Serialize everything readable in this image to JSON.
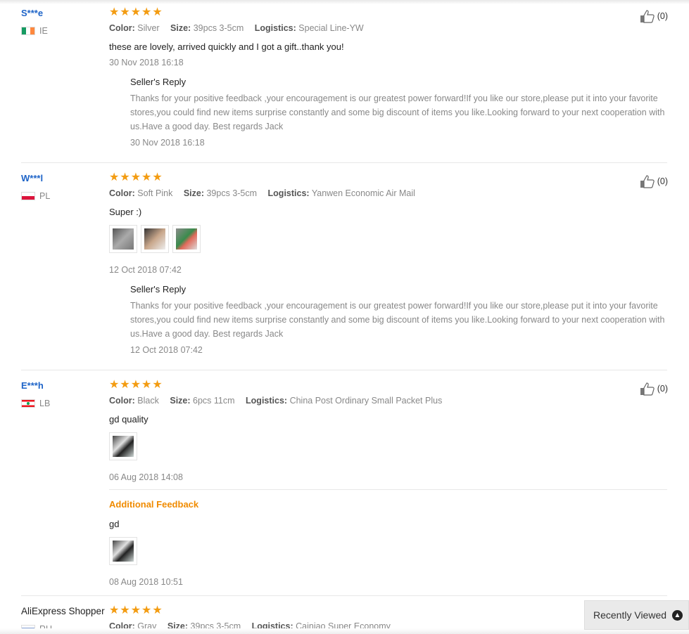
{
  "reviews": [
    {
      "user": "S***e",
      "country": "IE",
      "flag": "ireland-flag",
      "color_label": "Color:",
      "color": "Silver",
      "size_label": "Size:",
      "size": "39pcs 3-5cm",
      "logistics_label": "Logistics:",
      "logistics": "Special Line-YW",
      "text": "these are lovely, arrived quickly and I got a gift..thank you!",
      "date": "30 Nov 2018 16:18",
      "helpful": "(0)",
      "reply": {
        "title": "Seller's Reply",
        "body": "Thanks for your positive feedback ,your encouragement is our greatest power forward!If you like our store,please put it into your favorite stores,you could find new items surprise constantly and some big discount of items you like.Looking forward to your next cooperation with us.Have a good day. Best regards Jack",
        "date": "30 Nov 2018 16:18"
      }
    },
    {
      "user": "W***l",
      "country": "PL",
      "flag": "poland-flag",
      "color_label": "Color:",
      "color": "Soft Pink",
      "size_label": "Size:",
      "size": "39pcs 3-5cm",
      "logistics_label": "Logistics:",
      "logistics": "Yanwen Economic Air Mail",
      "text": "Super :)",
      "date": "12 Oct 2018 07:42",
      "helpful": "(0)",
      "reply": {
        "title": "Seller's Reply",
        "body": "Thanks for your positive feedback ,your encouragement is our greatest power forward!If you like our store,please put it into your favorite stores,you could find new items surprise constantly and some big discount of items you like.Looking forward to your next cooperation with us.Have a good day. Best regards Jack",
        "date": "12 Oct 2018 07:42"
      }
    },
    {
      "user": "E***h",
      "country": "LB",
      "flag": "lebanon-flag",
      "color_label": "Color:",
      "color": "Black",
      "size_label": "Size:",
      "size": "6pcs 11cm",
      "logistics_label": "Logistics:",
      "logistics": "China Post Ordinary Small Packet Plus",
      "text": "gd quality",
      "date": "06 Aug 2018 14:08",
      "helpful": "(0)",
      "additional": {
        "title": "Additional Feedback",
        "text": "gd",
        "date": "08 Aug 2018 10:51"
      }
    },
    {
      "user": "AliExpress Shopper",
      "country": "RU",
      "flag": "russia-flag",
      "color_label": "Color:",
      "color": "Gray",
      "size_label": "Size:",
      "size": "39pcs 3-5cm",
      "logistics_label": "Logistics:",
      "logistics": "Cainiao Super Economy"
    }
  ],
  "rating_stars": 5,
  "recently_viewed": "Recently Viewed",
  "colors": {
    "username": "#1e64c8",
    "star": "#f39c12",
    "additional_feedback": "#f08b00"
  }
}
